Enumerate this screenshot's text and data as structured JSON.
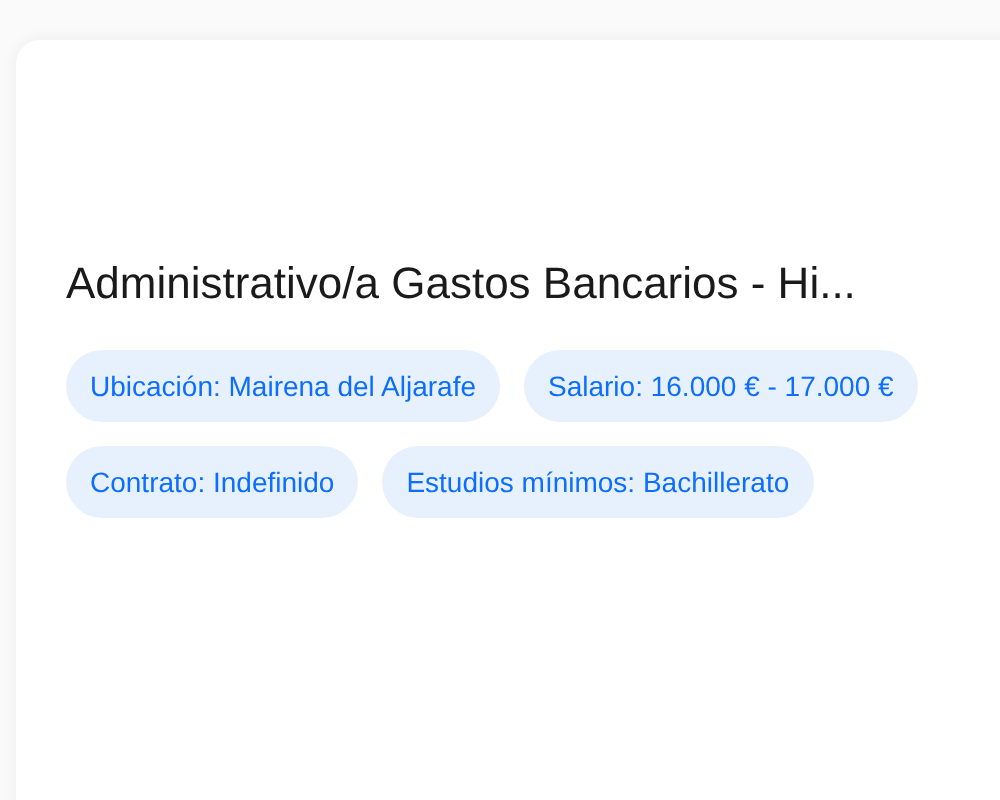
{
  "job": {
    "title": "Administrativo/a Gastos Bancarios - Hi...",
    "tags": [
      "Ubicación: Mairena del Aljarafe",
      "Salario: 16.000 € - 17.000 €",
      "Contrato: Indefinido",
      "Estudios mínimos: Bachillerato"
    ]
  }
}
